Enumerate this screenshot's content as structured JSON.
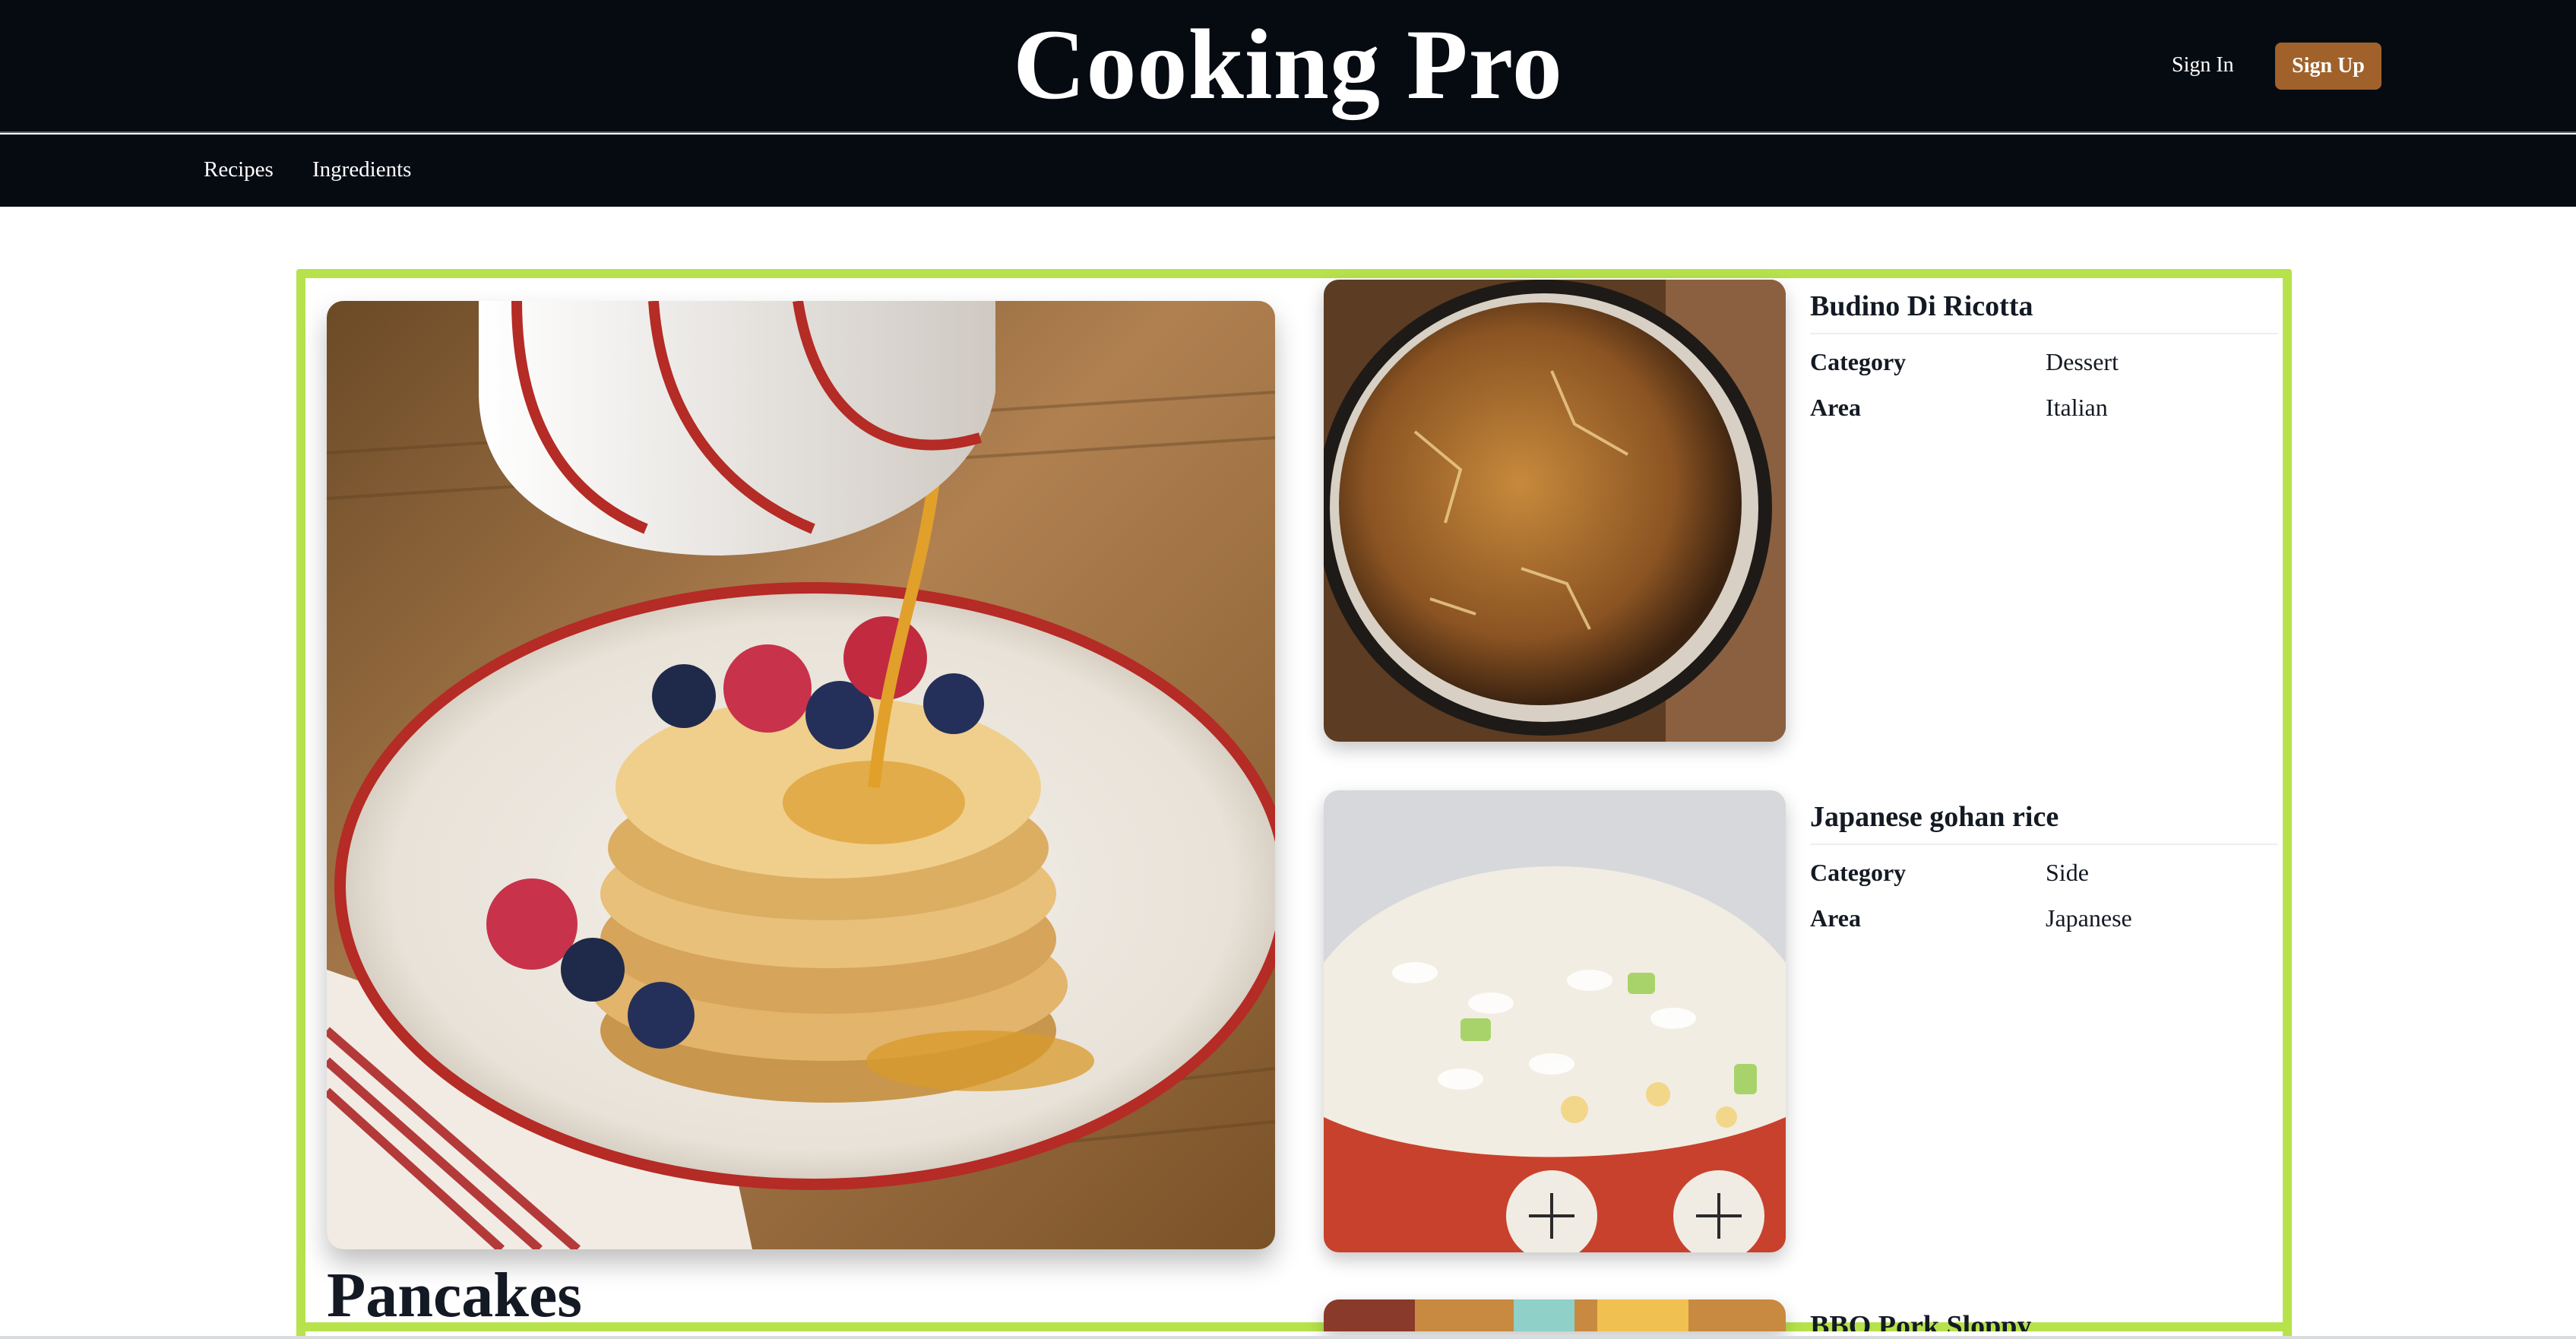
{
  "header": {
    "title": "Cooking Pro",
    "signin_label": "Sign In",
    "signup_label": "Sign Up",
    "signup_color": "#a0622a"
  },
  "nav": {
    "items": [
      {
        "label": "Recipes"
      },
      {
        "label": "Ingredients"
      }
    ]
  },
  "featured": {
    "title": "Pancakes",
    "highlight_color": "#b7e24c"
  },
  "recipes": [
    {
      "title": "Budino Di Ricotta",
      "category_label": "Category",
      "category": "Dessert",
      "area_label": "Area",
      "area": "Italian"
    },
    {
      "title": "Japanese gohan rice",
      "category_label": "Category",
      "category": "Side",
      "area_label": "Area",
      "area": "Japanese"
    },
    {
      "title": "BBQ Pork Sloppy"
    }
  ]
}
